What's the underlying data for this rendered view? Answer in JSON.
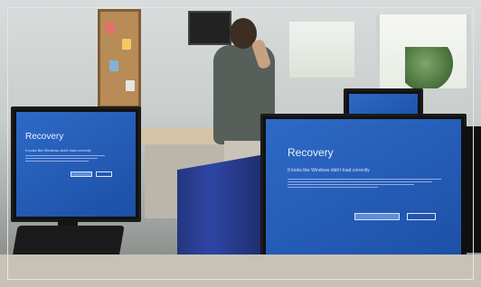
{
  "scene": {
    "description_free": true,
    "left_screen": {
      "title": "Recovery",
      "subtitle": "It looks like Windows didn't load correctly"
    },
    "right_screen": {
      "title": "Recovery",
      "subtitle": "It looks like Windows didn't load correctly"
    },
    "colors": {
      "bsod_blue": "#2d6ac6",
      "divider_blue": "#2f45a4"
    }
  }
}
